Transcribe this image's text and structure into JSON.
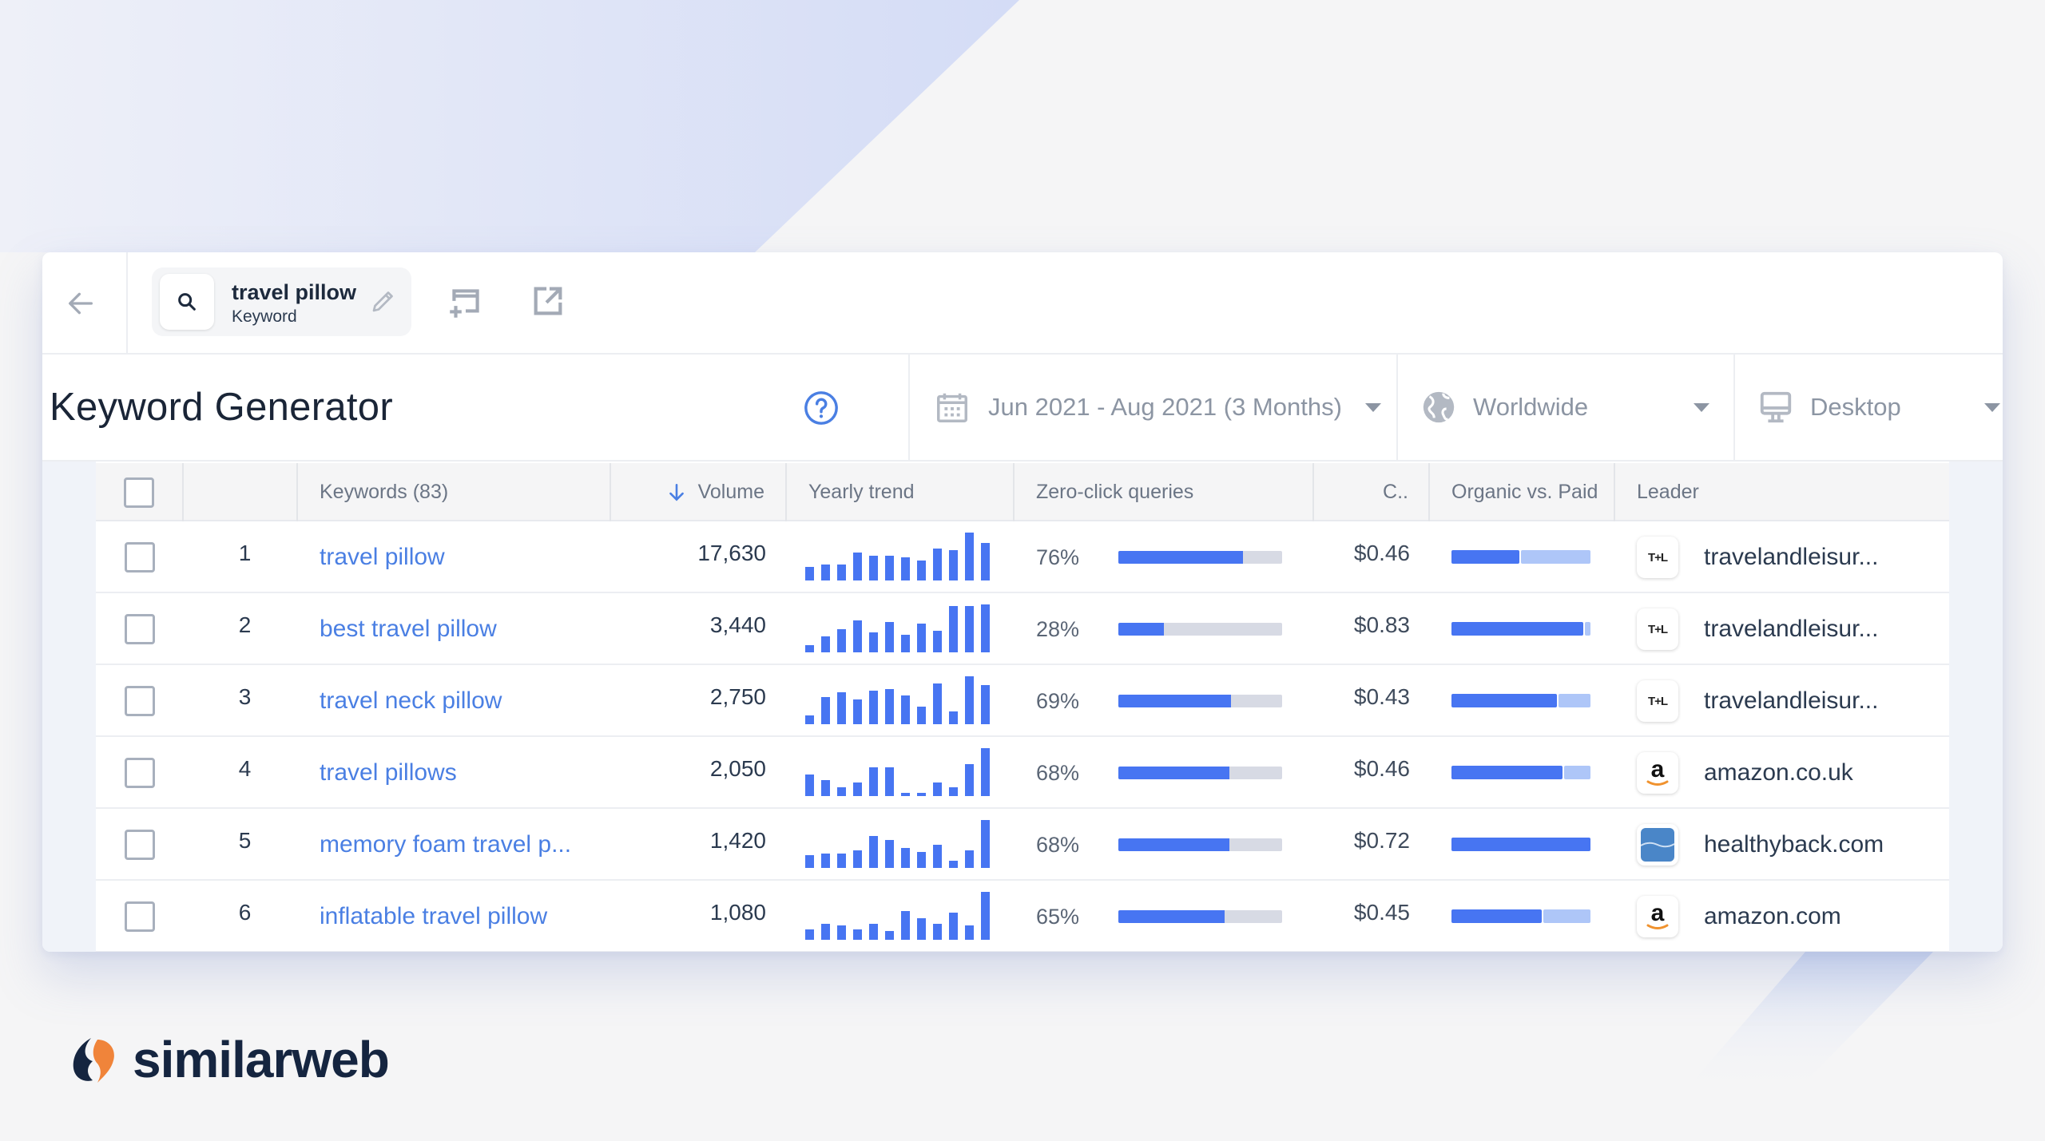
{
  "topbar": {
    "search_chip": {
      "title": "travel pillow",
      "subtitle": "Keyword"
    }
  },
  "page": {
    "title": "Keyword Generator"
  },
  "filters": {
    "date_range": "Jun 2021 - Aug 2021 (3 Months)",
    "country": "Worldwide",
    "device": "Desktop"
  },
  "table": {
    "columns": {
      "keywords": "Keywords (83)",
      "volume": "Volume",
      "yearly_trend": "Yearly trend",
      "zero_click": "Zero-click queries",
      "cpc": "C..",
      "organic_paid": "Organic vs. Paid",
      "leader": "Leader"
    },
    "sort": {
      "column": "volume",
      "direction": "descending"
    },
    "rows": [
      {
        "index": "1",
        "keyword": "travel pillow",
        "volume": "17,630",
        "trend": [
          0.29,
          0.33,
          0.33,
          0.59,
          0.52,
          0.52,
          0.48,
          0.41,
          0.67,
          0.63,
          1.0,
          0.78
        ],
        "zero_click": "76%",
        "zero_click_value": 76,
        "cpc": "$0.46",
        "organic_share": 49,
        "leader": "travelandleisur...",
        "leader_icon": "travel-leisure-logo"
      },
      {
        "index": "2",
        "keyword": "best travel pillow",
        "volume": "3,440",
        "trend": [
          0.15,
          0.34,
          0.48,
          0.66,
          0.41,
          0.63,
          0.37,
          0.6,
          0.45,
          0.97,
          0.97,
          1.0
        ],
        "zero_click": "28%",
        "zero_click_value": 28,
        "cpc": "$0.83",
        "organic_share": 95,
        "leader": "travelandleisur...",
        "leader_icon": "travel-leisure-logo"
      },
      {
        "index": "3",
        "keyword": "travel neck pillow",
        "volume": "2,750",
        "trend": [
          0.19,
          0.56,
          0.66,
          0.52,
          0.7,
          0.74,
          0.6,
          0.37,
          0.85,
          0.26,
          1.0,
          0.81
        ],
        "zero_click": "69%",
        "zero_click_value": 69,
        "cpc": "$0.43",
        "organic_share": 76,
        "leader": "travelandleisur...",
        "leader_icon": "travel-leisure-logo"
      },
      {
        "index": "4",
        "keyword": "travel pillows",
        "volume": "2,050",
        "trend": [
          0.45,
          0.33,
          0.19,
          0.29,
          0.6,
          0.6,
          0.07,
          0.07,
          0.29,
          0.19,
          0.66,
          1.0
        ],
        "zero_click": "68%",
        "zero_click_value": 68,
        "cpc": "$0.46",
        "organic_share": 80,
        "leader": "amazon.co.uk",
        "leader_icon": "amazon-logo"
      },
      {
        "index": "5",
        "keyword": "memory foam travel p...",
        "volume": "1,420",
        "trend": [
          0.26,
          0.3,
          0.3,
          0.37,
          0.66,
          0.59,
          0.41,
          0.34,
          0.48,
          0.15,
          0.37,
          1.0
        ],
        "zero_click": "68%",
        "zero_click_value": 68,
        "cpc": "$0.72",
        "organic_share": 100,
        "leader": "healthyback.com",
        "leader_icon": "healthyback-logo"
      },
      {
        "index": "6",
        "keyword": "inflatable travel pillow",
        "volume": "1,080",
        "trend": [
          0.22,
          0.34,
          0.3,
          0.22,
          0.34,
          0.19,
          0.6,
          0.45,
          0.34,
          0.56,
          0.3,
          1.0
        ],
        "zero_click": "65%",
        "zero_click_value": 65,
        "cpc": "$0.45",
        "organic_share": 65,
        "leader": "amazon.com",
        "leader_icon": "amazon-logo"
      }
    ]
  },
  "icons": {
    "travel_leisure_glyph": "T+L",
    "amazon_glyph": "a"
  },
  "branding": {
    "logo_text": "similarweb",
    "colors": {
      "accent_blue": "#4775f2",
      "paid_blue": "#aec6f8",
      "link_blue": "#4a7fe3",
      "logo_navy": "#152540",
      "logo_orange": "#f0843a"
    }
  }
}
